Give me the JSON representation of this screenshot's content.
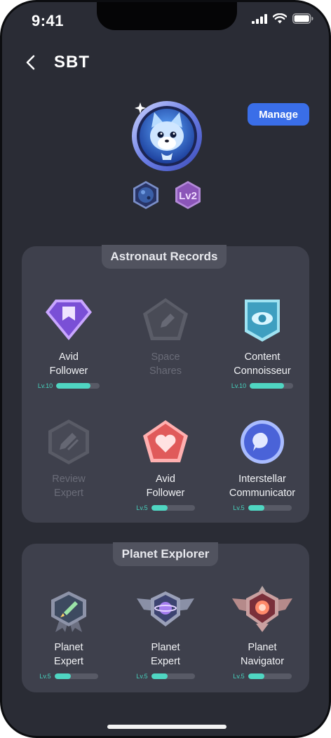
{
  "status": {
    "time": "9:41"
  },
  "header": {
    "title": "SBT"
  },
  "actions": {
    "manage_label": "Manage"
  },
  "profile": {
    "level_badge": "Lv2"
  },
  "sections": [
    {
      "title": "Astronaut Records",
      "badges": [
        {
          "name_line1": "Avid",
          "name_line2": "Follower",
          "level": "Lv.10",
          "progress": 0.78,
          "unlocked": true
        },
        {
          "name_line1": "Space",
          "name_line2": "Shares",
          "unlocked": false
        },
        {
          "name_line1": "Content",
          "name_line2": "Connoisseur",
          "level": "Lv.10",
          "progress": 0.78,
          "unlocked": true
        },
        {
          "name_line1": "Review",
          "name_line2": "Expert",
          "unlocked": false
        },
        {
          "name_line1": "Avid",
          "name_line2": "Follower",
          "level": "Lv.5",
          "progress": 0.38,
          "unlocked": true
        },
        {
          "name_line1": "Interstellar",
          "name_line2": "Communicator",
          "level": "Lv.5",
          "progress": 0.38,
          "unlocked": true
        }
      ]
    },
    {
      "title": "Planet Explorer",
      "badges": [
        {
          "name_line1": "Planet",
          "name_line2": "Expert",
          "level": "Lv.5",
          "progress": 0.38,
          "unlocked": true
        },
        {
          "name_line1": "Planet",
          "name_line2": "Expert",
          "level": "Lv.5",
          "progress": 0.38,
          "unlocked": true
        },
        {
          "name_line1": "Planet",
          "name_line2": "Navigator",
          "level": "Lv.5",
          "progress": 0.38,
          "unlocked": true
        }
      ]
    }
  ],
  "colors": {
    "accent": "#3a6ee8",
    "progress": "#4fd6c2",
    "card": "#3e404c",
    "background": "#2a2c35"
  }
}
